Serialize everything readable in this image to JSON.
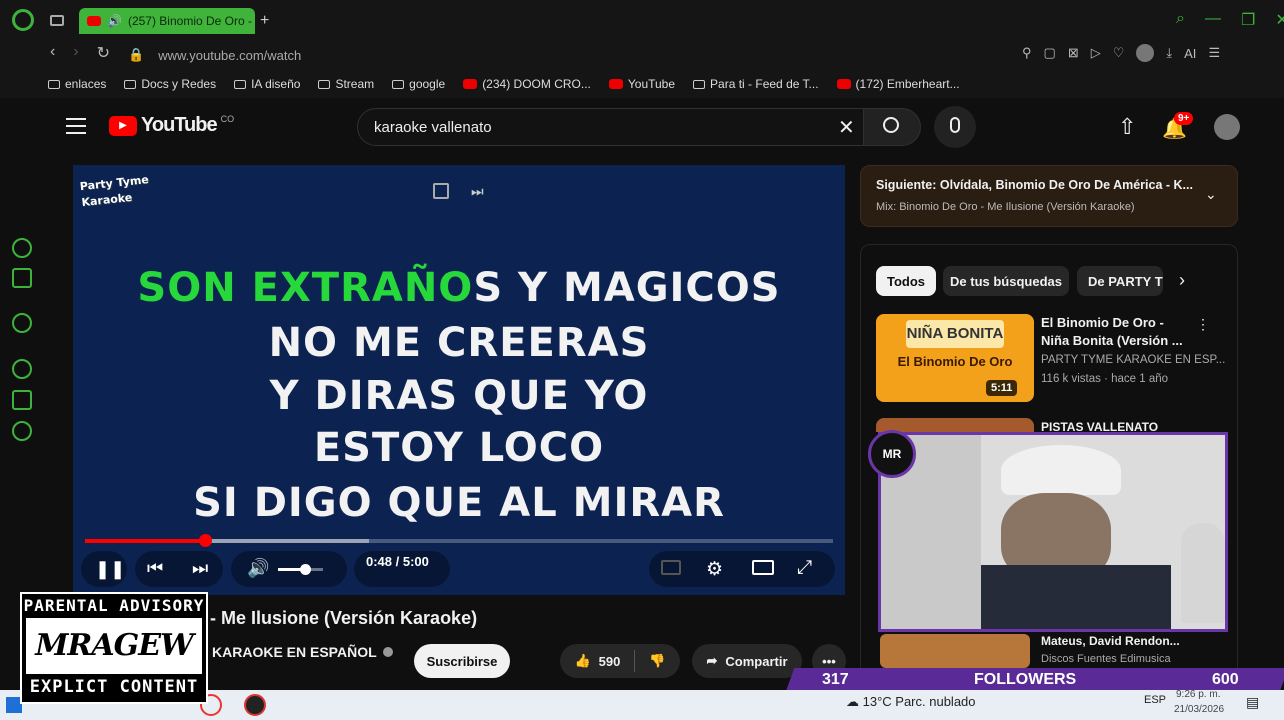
{
  "browser": {
    "tab_title": "(257) Binomio De Oro -",
    "url": "www.youtube.com/watch",
    "bookmarks": [
      "enlaces",
      "Docs y Redes",
      "IA diseño",
      "Stream",
      "google",
      "(234) DOOM CRO...",
      "YouTube",
      "Para ti - Feed de T...",
      "(172) Emberheart..."
    ],
    "ai_label": "AI"
  },
  "youtube": {
    "logo_text": "YouTube",
    "country": "CO",
    "search_value": "karaoke vallenato",
    "notif_badge": "9+"
  },
  "player": {
    "watermark": "Party Tyme Karaoke",
    "lyrics": [
      {
        "hl": "SON EXTRAÑO",
        "rest": "S Y MAGICOS"
      },
      {
        "hl": "",
        "rest": "NO ME CREERAS"
      },
      {
        "hl": "",
        "rest": "Y DIRAS QUE YO"
      },
      {
        "hl": "",
        "rest": "ESTOY LOCO"
      },
      {
        "hl": "",
        "rest": "SI DIGO QUE AL MIRAR"
      }
    ],
    "time": "0:48 / 5:00",
    "progress_fraction": 0.16,
    "buffer_fraction": 0.38,
    "volume_fraction": 0.6
  },
  "video": {
    "title": "- Me Ilusione (Versión Karaoke)",
    "channel": "KARAOKE EN ESPAÑOL",
    "subscribe": "Suscribirse",
    "likes": "590",
    "share": "Compartir"
  },
  "upnext": {
    "title": "Siguiente: Olvídala, Binomio De Oro De América - K...",
    "sub": "Mix: Binomio De Oro - Me Ilusione (Versión Karaoke)"
  },
  "chips": [
    "Todos",
    "De tus búsquedas",
    "De PARTY T"
  ],
  "recs": [
    {
      "thumb_title": "NIÑA BONITA",
      "thumb_sub": "El Binomio De Oro",
      "duration": "5:11",
      "title": "El Binomio De Oro - Niña Bonita (Versión ...",
      "channel": "PARTY TYME KARAOKE EN ESP...",
      "meta": "116 k vistas · hace 1 año"
    },
    {
      "title": "PISTAS VALLENATO"
    },
    {
      "title": "Mateus, David Rendon...",
      "channel": "Discos Fuentes Edimusica"
    }
  ],
  "stream": {
    "followers_current": "317",
    "followers_label": "FOLLOWERS",
    "followers_goal": "600",
    "avatar_text": "MR"
  },
  "advisory": {
    "line1": "PARENTAL ADVISORY",
    "logo": "MRAGEW",
    "line2": "EXPLICT CONTENT"
  },
  "taskbar": {
    "weather": "13°C  Parc. nublado",
    "lang": "ESP",
    "time": "9:26 p. m.",
    "date": "21/03/2026"
  },
  "colors": {
    "accent_green": "#27d83b",
    "yt_red": "#ff0000",
    "follow_purple": "#5a2b97"
  }
}
